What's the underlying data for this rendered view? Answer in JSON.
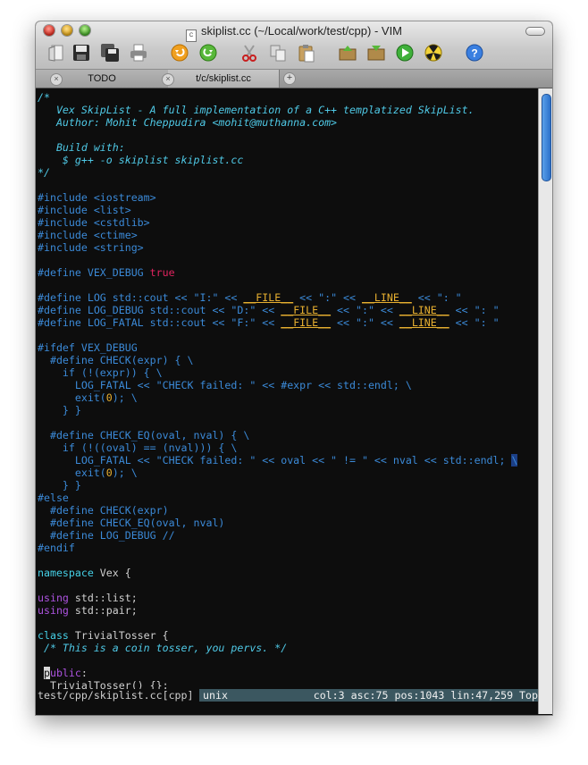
{
  "window": {
    "title": "skiplist.cc (~/Local/work/test/cpp) - VIM"
  },
  "toolbar": {
    "buttons": [
      "open-icon",
      "save-icon",
      "save-all-icon",
      "print-icon",
      "undo-icon",
      "redo-icon",
      "cut-icon",
      "copy-icon",
      "paste-icon",
      "load-session-icon",
      "save-session-icon",
      "run-icon",
      "build-icon",
      "help-icon"
    ]
  },
  "tabs": [
    {
      "label": "TODO",
      "active": false
    },
    {
      "label": "t/c/skiplist.cc",
      "active": true
    }
  ],
  "colors": {
    "comment": "#4fc9e6",
    "preproc": "#3b8ad8",
    "keyword": "#ad53e0",
    "type": "#45d0e6",
    "text": "#d0d0d0",
    "constant": "#e0245f",
    "number": "#e8b030",
    "underlined": "#e8b030",
    "statusbar": "#3b5760"
  },
  "code_lines": [
    [
      {
        "t": "/*",
        "c": "comment"
      }
    ],
    [
      {
        "t": "   Vex SkipList - A full implementation of a C++ templatized SkipList.",
        "c": "comment"
      }
    ],
    [
      {
        "t": "   Author: Mohit Cheppudira <mohit@muthanna.com>",
        "c": "comment"
      }
    ],
    [],
    [
      {
        "t": "   Build with:",
        "c": "comment"
      }
    ],
    [
      {
        "t": "    $ g++ -o skiplist skiplist.cc",
        "c": "comment"
      }
    ],
    [
      {
        "t": "*/",
        "c": "comment"
      }
    ],
    [],
    [
      {
        "t": "#include <iostream>",
        "c": "preproc"
      }
    ],
    [
      {
        "t": "#include <list>",
        "c": "preproc"
      }
    ],
    [
      {
        "t": "#include <cstdlib>",
        "c": "preproc"
      }
    ],
    [
      {
        "t": "#include <ctime>",
        "c": "preproc"
      }
    ],
    [
      {
        "t": "#include <string>",
        "c": "preproc"
      }
    ],
    [],
    [
      {
        "t": "#define VEX_DEBUG ",
        "c": "preproc"
      },
      {
        "t": "true",
        "c": "constant"
      }
    ],
    [],
    [
      {
        "t": "#define LOG std::cout << \"I:\" << ",
        "c": "preproc"
      },
      {
        "t": "__FILE__",
        "c": "underlined",
        "u": true
      },
      {
        "t": " << \":\" << ",
        "c": "preproc"
      },
      {
        "t": "__LINE__",
        "c": "underlined",
        "u": true
      },
      {
        "t": " << \": \"",
        "c": "preproc"
      }
    ],
    [
      {
        "t": "#define LOG_DEBUG std::cout << \"D:\" << ",
        "c": "preproc"
      },
      {
        "t": "__FILE__",
        "c": "underlined",
        "u": true
      },
      {
        "t": " << \":\" << ",
        "c": "preproc"
      },
      {
        "t": "__LINE__",
        "c": "underlined",
        "u": true
      },
      {
        "t": " << \": \"",
        "c": "preproc"
      }
    ],
    [
      {
        "t": "#define LOG_FATAL std::cout << \"F:\" << ",
        "c": "preproc"
      },
      {
        "t": "__FILE__",
        "c": "underlined",
        "u": true
      },
      {
        "t": " << \":\" << ",
        "c": "preproc"
      },
      {
        "t": "__LINE__",
        "c": "underlined",
        "u": true
      },
      {
        "t": " << \": \"",
        "c": "preproc"
      }
    ],
    [],
    [
      {
        "t": "#ifdef VEX_DEBUG",
        "c": "preproc"
      }
    ],
    [
      {
        "t": "  #define CHECK(expr) { \\",
        "c": "preproc"
      }
    ],
    [
      {
        "t": "    if (!(expr)) { \\",
        "c": "preproc"
      }
    ],
    [
      {
        "t": "      LOG_FATAL << \"CHECK failed: \" << #expr << std::endl; \\",
        "c": "preproc"
      }
    ],
    [
      {
        "t": "      exit(",
        "c": "preproc"
      },
      {
        "t": "0",
        "c": "number"
      },
      {
        "t": "); \\",
        "c": "preproc"
      }
    ],
    [
      {
        "t": "    } }",
        "c": "preproc"
      }
    ],
    [],
    [
      {
        "t": "  #define CHECK_EQ(oval, nval) { \\",
        "c": "preproc"
      }
    ],
    [
      {
        "t": "    if (!((oval) == (nval))) { \\",
        "c": "preproc"
      }
    ],
    [
      {
        "t": "      LOG_FATAL << \"CHECK failed: \" << oval << \" != \" << nval << std::endl; ",
        "c": "preproc"
      },
      {
        "t": "\\",
        "c": "preproc",
        "hl": true
      }
    ],
    [
      {
        "t": "      exit(",
        "c": "preproc"
      },
      {
        "t": "0",
        "c": "number"
      },
      {
        "t": "); \\",
        "c": "preproc"
      }
    ],
    [
      {
        "t": "    } }",
        "c": "preproc"
      }
    ],
    [
      {
        "t": "#else",
        "c": "preproc"
      }
    ],
    [
      {
        "t": "  #define CHECK(expr)",
        "c": "preproc"
      }
    ],
    [
      {
        "t": "  #define CHECK_EQ(oval, nval)",
        "c": "preproc"
      }
    ],
    [
      {
        "t": "  #define LOG_DEBUG //",
        "c": "preproc"
      }
    ],
    [
      {
        "t": "#endif",
        "c": "preproc"
      }
    ],
    [],
    [
      {
        "t": "namespace",
        "c": "type"
      },
      {
        "t": " Vex {",
        "c": "text"
      }
    ],
    [],
    [
      {
        "t": "using",
        "c": "keyword"
      },
      {
        "t": " std::list;",
        "c": "text"
      }
    ],
    [
      {
        "t": "using",
        "c": "keyword"
      },
      {
        "t": " std::pair;",
        "c": "text"
      }
    ],
    [],
    [
      {
        "t": "class",
        "c": "type"
      },
      {
        "t": " TrivialTosser {",
        "c": "text"
      }
    ],
    [
      {
        "t": " /* This is a coin tosser, you pervs. */",
        "c": "comment"
      }
    ],
    [],
    [
      {
        "t": " ",
        "c": "text"
      },
      {
        "t": "p",
        "c": "keyword",
        "cursor": true
      },
      {
        "t": "ublic",
        "c": "keyword"
      },
      {
        "t": ":",
        "c": "text"
      }
    ],
    [
      {
        "t": "  TrivialTosser() {};",
        "c": "text"
      }
    ]
  ],
  "statusline": {
    "file": "test/cpp/skiplist.cc[cpp]",
    "fileformat": "unix",
    "position": "col:3 asc:75 pos:1043 lin:47,259 Top"
  }
}
